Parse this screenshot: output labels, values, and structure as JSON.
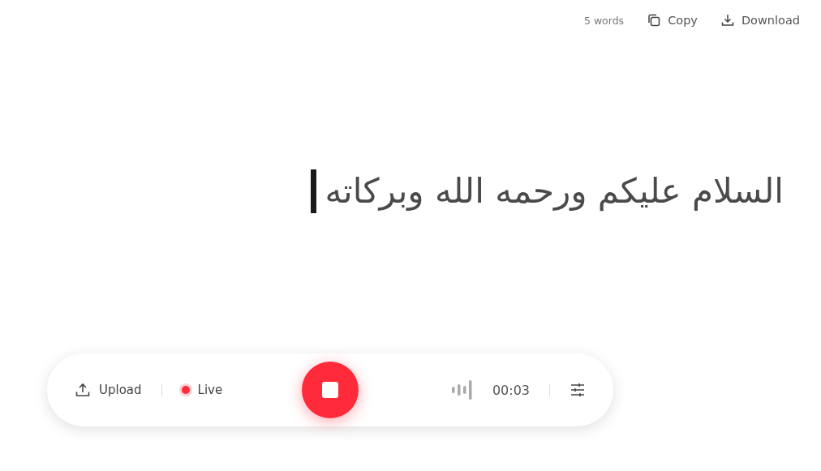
{
  "toolbar": {
    "word_count": "5 words",
    "actions": [
      {
        "kind": "copy",
        "label": "Copy"
      },
      {
        "kind": "download",
        "label": "Download"
      }
    ]
  },
  "transcript": {
    "text": "السلام عليكم ورحمه الله وبركاته",
    "cursor": true
  },
  "controls": {
    "upload": "Upload",
    "live": {
      "label": "Live",
      "on": true
    },
    "recording": true,
    "timer": "00:03"
  }
}
